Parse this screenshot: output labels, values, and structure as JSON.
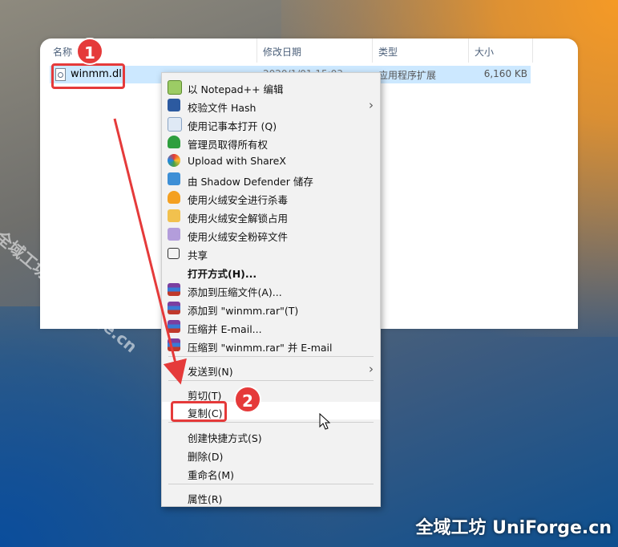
{
  "explorer": {
    "columns": {
      "name": "名称",
      "date": "修改日期",
      "type": "类型",
      "size": "大小"
    },
    "file": {
      "name": "winmm.dll",
      "date": "2020/1/01 15:03",
      "type": "应用程序扩展",
      "size": "6,160 KB"
    }
  },
  "context_menu": {
    "items": [
      {
        "label": "以 Notepad++ 编辑",
        "icon": "notepadpp-icon"
      },
      {
        "label": "校验文件 Hash",
        "icon": "powershell-icon",
        "submenu": true
      },
      {
        "label": "使用记事本打开 (Q)",
        "icon": "notepad-icon"
      },
      {
        "label": "管理员取得所有权",
        "icon": "shield-check-icon"
      },
      {
        "label": "Upload with ShareX",
        "icon": "sharex-icon"
      },
      {
        "label": "由 Shadow Defender 储存",
        "icon": "shadow-defender-icon"
      },
      {
        "label": "使用火绒安全进行杀毒",
        "icon": "huorong-flame-icon"
      },
      {
        "label": "使用火绒安全解锁占用",
        "icon": "huorong-unlock-icon"
      },
      {
        "label": "使用火绒安全粉碎文件",
        "icon": "huorong-shred-icon"
      },
      {
        "label": "共享",
        "icon": "share-icon"
      },
      {
        "label": "打开方式(H)...",
        "icon": ""
      },
      {
        "label": "添加到压缩文件(A)...",
        "icon": "winrar-icon"
      },
      {
        "label": "添加到 \"winmm.rar\"(T)",
        "icon": "winrar-icon"
      },
      {
        "label": "压缩并 E-mail...",
        "icon": "winrar-icon"
      },
      {
        "label": "压缩到 \"winmm.rar\" 并 E-mail",
        "icon": "winrar-icon"
      },
      {
        "label": "发送到(N)",
        "icon": "",
        "submenu": true
      },
      {
        "label": "剪切(T)",
        "icon": ""
      },
      {
        "label": "复制(C)",
        "icon": ""
      },
      {
        "label": "创建快捷方式(S)",
        "icon": ""
      },
      {
        "label": "删除(D)",
        "icon": ""
      },
      {
        "label": "重命名(M)",
        "icon": ""
      },
      {
        "label": "属性(R)",
        "icon": ""
      }
    ]
  },
  "annotations": {
    "step1": "1",
    "step2": "2",
    "accent": "#e53a3a"
  },
  "watermark": {
    "diagonal": "全域工坊 UniForge.cn",
    "corner": "全域工坊 UniForge.cn"
  }
}
